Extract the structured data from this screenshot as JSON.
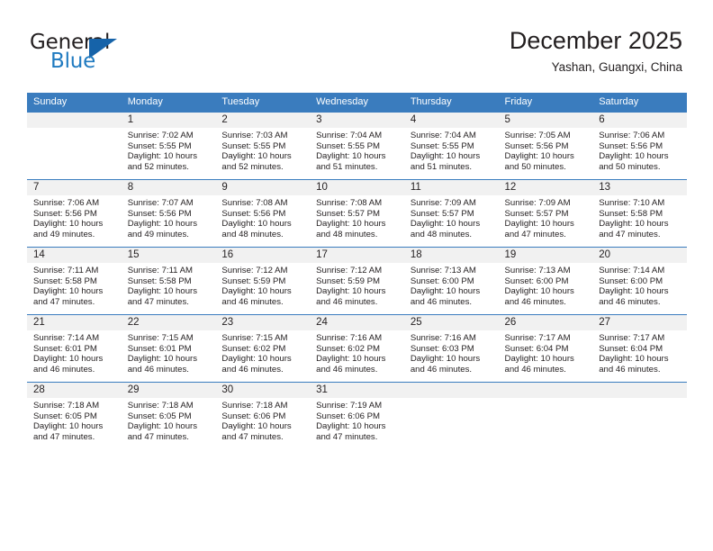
{
  "brand": {
    "name_top": "General",
    "name_bottom": "Blue",
    "triangle_color": "#1663a9",
    "blue_color": "#1f7ac0"
  },
  "header": {
    "title": "December 2025",
    "location": "Yashan, Guangxi, China"
  },
  "theme": {
    "header_bg": "#3a7cbe",
    "header_text": "#ffffff",
    "day_band_bg": "#f1f1f1",
    "body_text": "#231f20"
  },
  "weekday_headers": [
    "Sunday",
    "Monday",
    "Tuesday",
    "Wednesday",
    "Thursday",
    "Friday",
    "Saturday"
  ],
  "labels": {
    "sunrise_prefix": "Sunrise: ",
    "sunset_prefix": "Sunset: ",
    "daylight_prefix": "Daylight: "
  },
  "weeks": [
    [
      {
        "day": "",
        "sunrise": "",
        "sunset": "",
        "daylight_line1": "",
        "daylight_line2": "",
        "blank": true
      },
      {
        "day": "1",
        "sunrise": "Sunrise: 7:02 AM",
        "sunset": "Sunset: 5:55 PM",
        "daylight_line1": "Daylight: 10 hours",
        "daylight_line2": "and 52 minutes."
      },
      {
        "day": "2",
        "sunrise": "Sunrise: 7:03 AM",
        "sunset": "Sunset: 5:55 PM",
        "daylight_line1": "Daylight: 10 hours",
        "daylight_line2": "and 52 minutes."
      },
      {
        "day": "3",
        "sunrise": "Sunrise: 7:04 AM",
        "sunset": "Sunset: 5:55 PM",
        "daylight_line1": "Daylight: 10 hours",
        "daylight_line2": "and 51 minutes."
      },
      {
        "day": "4",
        "sunrise": "Sunrise: 7:04 AM",
        "sunset": "Sunset: 5:55 PM",
        "daylight_line1": "Daylight: 10 hours",
        "daylight_line2": "and 51 minutes."
      },
      {
        "day": "5",
        "sunrise": "Sunrise: 7:05 AM",
        "sunset": "Sunset: 5:56 PM",
        "daylight_line1": "Daylight: 10 hours",
        "daylight_line2": "and 50 minutes."
      },
      {
        "day": "6",
        "sunrise": "Sunrise: 7:06 AM",
        "sunset": "Sunset: 5:56 PM",
        "daylight_line1": "Daylight: 10 hours",
        "daylight_line2": "and 50 minutes."
      }
    ],
    [
      {
        "day": "7",
        "sunrise": "Sunrise: 7:06 AM",
        "sunset": "Sunset: 5:56 PM",
        "daylight_line1": "Daylight: 10 hours",
        "daylight_line2": "and 49 minutes."
      },
      {
        "day": "8",
        "sunrise": "Sunrise: 7:07 AM",
        "sunset": "Sunset: 5:56 PM",
        "daylight_line1": "Daylight: 10 hours",
        "daylight_line2": "and 49 minutes."
      },
      {
        "day": "9",
        "sunrise": "Sunrise: 7:08 AM",
        "sunset": "Sunset: 5:56 PM",
        "daylight_line1": "Daylight: 10 hours",
        "daylight_line2": "and 48 minutes."
      },
      {
        "day": "10",
        "sunrise": "Sunrise: 7:08 AM",
        "sunset": "Sunset: 5:57 PM",
        "daylight_line1": "Daylight: 10 hours",
        "daylight_line2": "and 48 minutes."
      },
      {
        "day": "11",
        "sunrise": "Sunrise: 7:09 AM",
        "sunset": "Sunset: 5:57 PM",
        "daylight_line1": "Daylight: 10 hours",
        "daylight_line2": "and 48 minutes."
      },
      {
        "day": "12",
        "sunrise": "Sunrise: 7:09 AM",
        "sunset": "Sunset: 5:57 PM",
        "daylight_line1": "Daylight: 10 hours",
        "daylight_line2": "and 47 minutes."
      },
      {
        "day": "13",
        "sunrise": "Sunrise: 7:10 AM",
        "sunset": "Sunset: 5:58 PM",
        "daylight_line1": "Daylight: 10 hours",
        "daylight_line2": "and 47 minutes."
      }
    ],
    [
      {
        "day": "14",
        "sunrise": "Sunrise: 7:11 AM",
        "sunset": "Sunset: 5:58 PM",
        "daylight_line1": "Daylight: 10 hours",
        "daylight_line2": "and 47 minutes."
      },
      {
        "day": "15",
        "sunrise": "Sunrise: 7:11 AM",
        "sunset": "Sunset: 5:58 PM",
        "daylight_line1": "Daylight: 10 hours",
        "daylight_line2": "and 47 minutes."
      },
      {
        "day": "16",
        "sunrise": "Sunrise: 7:12 AM",
        "sunset": "Sunset: 5:59 PM",
        "daylight_line1": "Daylight: 10 hours",
        "daylight_line2": "and 46 minutes."
      },
      {
        "day": "17",
        "sunrise": "Sunrise: 7:12 AM",
        "sunset": "Sunset: 5:59 PM",
        "daylight_line1": "Daylight: 10 hours",
        "daylight_line2": "and 46 minutes."
      },
      {
        "day": "18",
        "sunrise": "Sunrise: 7:13 AM",
        "sunset": "Sunset: 6:00 PM",
        "daylight_line1": "Daylight: 10 hours",
        "daylight_line2": "and 46 minutes."
      },
      {
        "day": "19",
        "sunrise": "Sunrise: 7:13 AM",
        "sunset": "Sunset: 6:00 PM",
        "daylight_line1": "Daylight: 10 hours",
        "daylight_line2": "and 46 minutes."
      },
      {
        "day": "20",
        "sunrise": "Sunrise: 7:14 AM",
        "sunset": "Sunset: 6:00 PM",
        "daylight_line1": "Daylight: 10 hours",
        "daylight_line2": "and 46 minutes."
      }
    ],
    [
      {
        "day": "21",
        "sunrise": "Sunrise: 7:14 AM",
        "sunset": "Sunset: 6:01 PM",
        "daylight_line1": "Daylight: 10 hours",
        "daylight_line2": "and 46 minutes."
      },
      {
        "day": "22",
        "sunrise": "Sunrise: 7:15 AM",
        "sunset": "Sunset: 6:01 PM",
        "daylight_line1": "Daylight: 10 hours",
        "daylight_line2": "and 46 minutes."
      },
      {
        "day": "23",
        "sunrise": "Sunrise: 7:15 AM",
        "sunset": "Sunset: 6:02 PM",
        "daylight_line1": "Daylight: 10 hours",
        "daylight_line2": "and 46 minutes."
      },
      {
        "day": "24",
        "sunrise": "Sunrise: 7:16 AM",
        "sunset": "Sunset: 6:02 PM",
        "daylight_line1": "Daylight: 10 hours",
        "daylight_line2": "and 46 minutes."
      },
      {
        "day": "25",
        "sunrise": "Sunrise: 7:16 AM",
        "sunset": "Sunset: 6:03 PM",
        "daylight_line1": "Daylight: 10 hours",
        "daylight_line2": "and 46 minutes."
      },
      {
        "day": "26",
        "sunrise": "Sunrise: 7:17 AM",
        "sunset": "Sunset: 6:04 PM",
        "daylight_line1": "Daylight: 10 hours",
        "daylight_line2": "and 46 minutes."
      },
      {
        "day": "27",
        "sunrise": "Sunrise: 7:17 AM",
        "sunset": "Sunset: 6:04 PM",
        "daylight_line1": "Daylight: 10 hours",
        "daylight_line2": "and 46 minutes."
      }
    ],
    [
      {
        "day": "28",
        "sunrise": "Sunrise: 7:18 AM",
        "sunset": "Sunset: 6:05 PM",
        "daylight_line1": "Daylight: 10 hours",
        "daylight_line2": "and 47 minutes."
      },
      {
        "day": "29",
        "sunrise": "Sunrise: 7:18 AM",
        "sunset": "Sunset: 6:05 PM",
        "daylight_line1": "Daylight: 10 hours",
        "daylight_line2": "and 47 minutes."
      },
      {
        "day": "30",
        "sunrise": "Sunrise: 7:18 AM",
        "sunset": "Sunset: 6:06 PM",
        "daylight_line1": "Daylight: 10 hours",
        "daylight_line2": "and 47 minutes."
      },
      {
        "day": "31",
        "sunrise": "Sunrise: 7:19 AM",
        "sunset": "Sunset: 6:06 PM",
        "daylight_line1": "Daylight: 10 hours",
        "daylight_line2": "and 47 minutes."
      },
      {
        "day": "",
        "sunrise": "",
        "sunset": "",
        "daylight_line1": "",
        "daylight_line2": "",
        "blank": true
      },
      {
        "day": "",
        "sunrise": "",
        "sunset": "",
        "daylight_line1": "",
        "daylight_line2": "",
        "blank": true
      },
      {
        "day": "",
        "sunrise": "",
        "sunset": "",
        "daylight_line1": "",
        "daylight_line2": "",
        "blank": true
      }
    ]
  ]
}
